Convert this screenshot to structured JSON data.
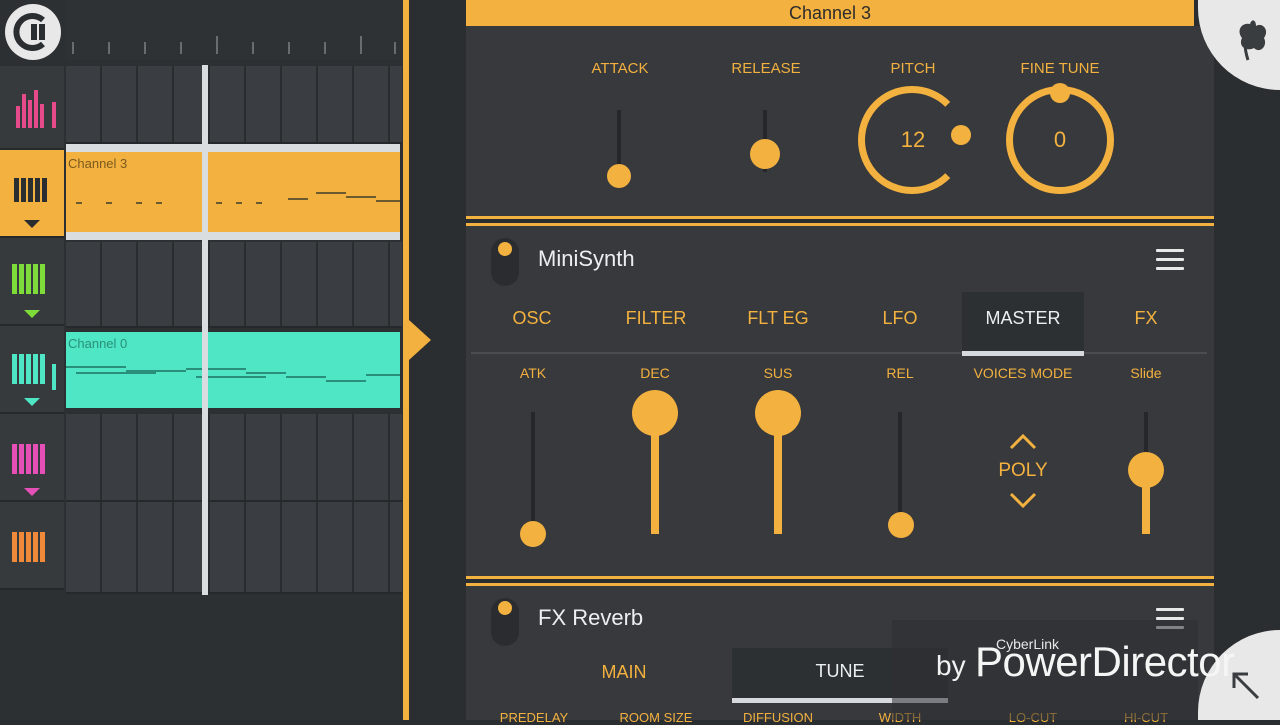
{
  "channel_bar": {
    "title": "Channel 3"
  },
  "sampler": {
    "attack_label": "ATTACK",
    "release_label": "RELEASE",
    "pitch_label": "PITCH",
    "pitch_value": "12",
    "finetune_label": "FINE TUNE",
    "finetune_value": "0",
    "attack_level": 0.0,
    "release_level": 0.3
  },
  "minisynth": {
    "title": "MiniSynth",
    "tabs": [
      "OSC",
      "FILTER",
      "FLT EG",
      "LFO",
      "MASTER",
      "FX"
    ],
    "active_tab": "MASTER",
    "controls": {
      "atk": {
        "label": "ATK",
        "level": 0.0
      },
      "dec": {
        "label": "DEC",
        "level": 1.0
      },
      "sus": {
        "label": "SUS",
        "level": 1.0
      },
      "rel": {
        "label": "REL",
        "level": 0.0
      },
      "voices_mode": {
        "label": "VOICES MODE",
        "value": "POLY"
      },
      "slide": {
        "label": "Slide",
        "level": 0.45
      }
    }
  },
  "fx_reverb": {
    "title": "FX Reverb",
    "tabs": [
      "MAIN",
      "TUNE"
    ],
    "active_tab": "TUNE",
    "params": [
      "PREDELAY",
      "ROOM SIZE",
      "DIFFUSION",
      "WIDTH",
      "LO-CUT",
      "HI-CUT"
    ]
  },
  "tracks": [
    {
      "label": "Channel 3",
      "color": "#f3b13f"
    },
    {
      "label": "Channel 0",
      "color": "#4ee6c4"
    }
  ],
  "colors": {
    "accent": "#f3b13f",
    "teal": "#4ee6c4",
    "green": "#7ddc3a",
    "magenta": "#e64fb6",
    "orange": "#f08a3a",
    "pink": "#e64a8b"
  },
  "watermark": {
    "brand_small": "CyberLink",
    "by": "by",
    "brand": "PowerDirector"
  }
}
